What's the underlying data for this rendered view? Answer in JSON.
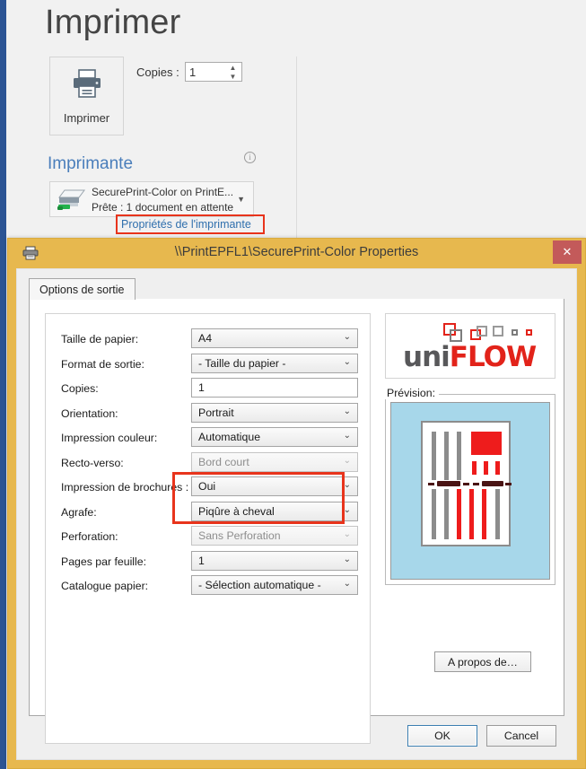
{
  "backstage": {
    "page_title": "Imprimer",
    "print_button_label": "Imprimer",
    "print_icon": "printer-icon",
    "copies_label": "Copies :",
    "copies_value": "1",
    "spinner_up": "▲",
    "spinner_down": "▼",
    "printer_section_title": "Imprimante",
    "info_icon_glyph": "i",
    "printer_name": "SecurePrint-Color on PrintE...",
    "printer_status": "Prête : 1 document en attente",
    "printer_dropdown_caret": "▼",
    "printer_properties_link": "Propriétés de l'imprimante",
    "highlight_color": "#e8341c",
    "accent_color": "#4a7ebb",
    "sidebar_color": "#2c5494"
  },
  "dialog": {
    "title": "\\\\PrintEPFL1\\SecurePrint-Color Properties",
    "title_icon": "printer-icon",
    "close_label": "✕",
    "titlebar_color": "#e7b84e",
    "close_button_color": "#c35a5a",
    "tabs": [
      {
        "label": "Options de sortie",
        "active": true
      }
    ],
    "fields": [
      {
        "label": "Taille de papier:",
        "value": "A4",
        "type": "select",
        "disabled": false
      },
      {
        "label": "Format de sortie:",
        "value": "- Taille du papier -",
        "type": "select",
        "disabled": false
      },
      {
        "label": "Copies:",
        "value": "1",
        "type": "text",
        "disabled": false
      },
      {
        "label": "Orientation:",
        "value": "Portrait",
        "type": "select",
        "disabled": false
      },
      {
        "label": "Impression couleur:",
        "value": "Automatique",
        "type": "select",
        "disabled": false
      },
      {
        "label": "Recto-verso:",
        "value": "Bord court",
        "type": "select",
        "disabled": true
      },
      {
        "label": "Impression de brochures :",
        "value": "Oui",
        "type": "select",
        "disabled": false
      },
      {
        "label": "Agrafe:",
        "value": "Piqûre à cheval",
        "type": "select",
        "disabled": false
      },
      {
        "label": "Perforation:",
        "value": "Sans Perforation",
        "type": "select",
        "disabled": true
      },
      {
        "label": "Pages par feuille:",
        "value": "1",
        "type": "select",
        "disabled": false
      },
      {
        "label": "Catalogue papier:",
        "value": "- Sélection automatique -",
        "type": "select",
        "disabled": false
      }
    ],
    "highlighted_fields": [
      "Impression de brochures :",
      "Agrafe:"
    ],
    "chevron_glyph": "⌄",
    "logo": {
      "text_part1": "uni",
      "text_part2": "FLOW",
      "color1": "#58585a",
      "color2": "#e2231a"
    },
    "preview": {
      "legend": "Prévision:",
      "background_color": "#a7d7ea",
      "page_color": "#ffffff",
      "gray_color": "#8c8c8c",
      "red_color": "#ee1c1c",
      "staple_color": "#4a1414"
    },
    "about_button": "A propos de…",
    "ok_button": "OK",
    "cancel_button": "Cancel"
  }
}
